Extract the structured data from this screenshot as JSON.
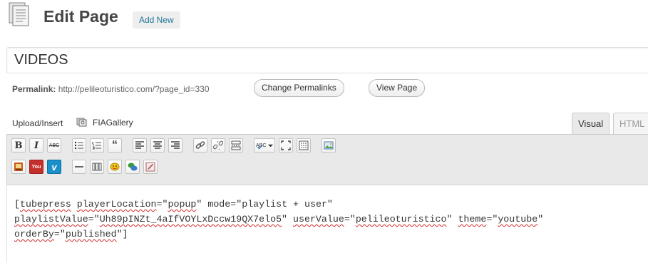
{
  "header": {
    "title": "Edit Page",
    "add_new": "Add New"
  },
  "title_input": {
    "value": "VIDEOS"
  },
  "permalink": {
    "label": "Permalink:",
    "url": "http://pelileoturistico.com/?page_id=330",
    "change_button": "Change Permalinks",
    "view_button": "View Page"
  },
  "media": {
    "upload_insert": "Upload/Insert",
    "gallery_label": "FIAGallery"
  },
  "tabs": {
    "visual": "Visual",
    "html": "HTML"
  },
  "toolbar": {
    "row1": [
      "bold",
      "italic",
      "strikethrough",
      "unordered-list",
      "ordered-list",
      "blockquote",
      "align-left",
      "align-center",
      "align-right",
      "link",
      "unlink",
      "more-tag",
      "spellcheck",
      "fullscreen",
      "kitchen-sink",
      "insert-image"
    ],
    "row2": [
      "fia-gallery",
      "youtube",
      "vimeo",
      "horizontal-rule",
      "columns",
      "smiley",
      "chat",
      "edit"
    ],
    "bold_label": "B",
    "italic_label": "I",
    "strike_label": "ABC",
    "spell_label": "ABC",
    "quote_label": "“",
    "youtube_label": "You",
    "vimeo_label": "v"
  },
  "editor": {
    "line1_a": "[",
    "line1_b": "tubepress",
    "line1_c": " ",
    "line1_d": "playerLocation",
    "line1_e": "=\"",
    "line1_f": "popup",
    "line1_g": "\" mode=\"playlist + user\"",
    "line2_a": "playlistValue",
    "line2_b": "=\"",
    "line2_c": "Uh89pINZt_4aIfVOYLxDccw19QX7elo5",
    "line2_d": "\" ",
    "line2_e": "userValue",
    "line2_f": "=\"",
    "line2_g": "pelileoturistico",
    "line2_h": "\" ",
    "line2_i": "theme",
    "line2_j": "=\"",
    "line2_k": "youtube",
    "line2_l": "\"",
    "line3_a": "orderBy",
    "line3_b": "=\"",
    "line3_c": "published",
    "line3_d": "\"]"
  }
}
